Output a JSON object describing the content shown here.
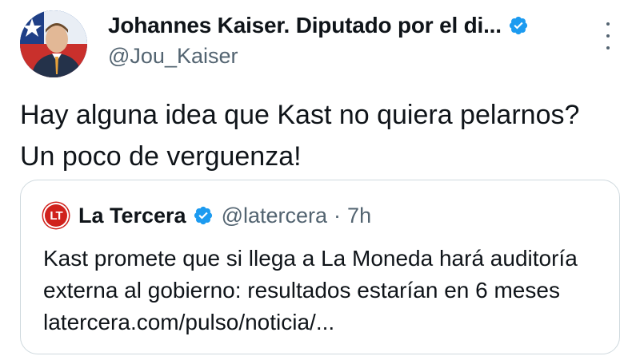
{
  "author": {
    "display_name": "Johannes Kaiser. Diputado por el di...",
    "handle": "@Jou_Kaiser",
    "verified": true
  },
  "tweet": {
    "text": "Hay alguna idea que Kast no quiera pelarnos? Un poco de verguenza!"
  },
  "quoted_tweet": {
    "logo_text": "LT",
    "display_name": "La Tercera",
    "verified": true,
    "handle": "@latercera",
    "separator": "·",
    "time": "7h",
    "text": "Kast promete que si llega a La Moneda hará auditoría externa al gobierno: resultados estarían en 6 meses latercera.com/pulso/noticia/..."
  },
  "colors": {
    "verified_blue": "#1d9bf0",
    "secondary_text": "#536471",
    "border": "#cfd9de",
    "la_tercera_red": "#d0211c"
  },
  "icons": {
    "avatar": "avatar",
    "verified": "verified-badge-icon",
    "more": "more-options-icon"
  }
}
